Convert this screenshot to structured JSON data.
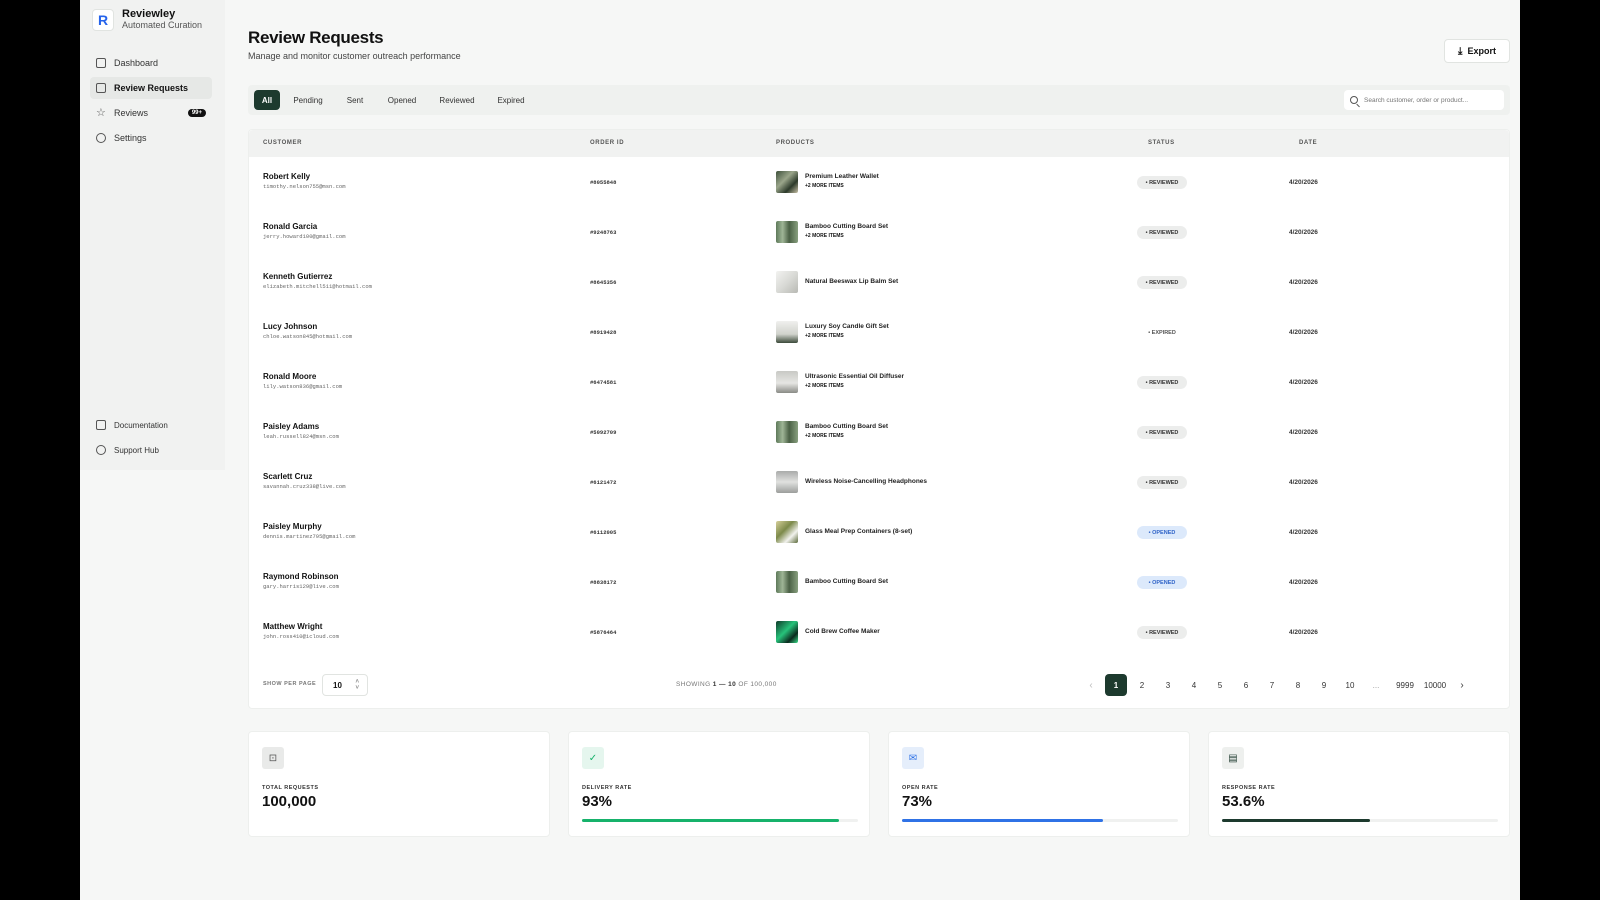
{
  "brand": {
    "name": "Reviewley",
    "tagline": "Automated Curation",
    "logo_letter": "R"
  },
  "sidebar": {
    "items": [
      {
        "label": "Dashboard",
        "icon": "grid-icon"
      },
      {
        "label": "Review Requests",
        "icon": "mail-icon",
        "active": true
      },
      {
        "label": "Reviews",
        "icon": "star-icon",
        "badge": "99+"
      },
      {
        "label": "Settings",
        "icon": "gear-icon"
      }
    ],
    "bottom": [
      {
        "label": "Documentation",
        "icon": "book-icon"
      },
      {
        "label": "Support Hub",
        "icon": "headset-icon"
      }
    ]
  },
  "header": {
    "title": "Review Requests",
    "subtitle": "Manage and monitor customer outreach performance",
    "export_label": "Export"
  },
  "filters": {
    "tabs": [
      "All",
      "Pending",
      "Sent",
      "Opened",
      "Reviewed",
      "Expired"
    ],
    "active": "All",
    "search_placeholder": "Search customer, order or product..."
  },
  "table": {
    "columns": [
      "CUSTOMER",
      "ORDER ID",
      "PRODUCTS",
      "STATUS",
      "DATE"
    ],
    "rows": [
      {
        "name": "Robert Kelly",
        "email": "timothy.nelson755@msn.com",
        "order": "#8055848",
        "product": "Premium Leather Wallet",
        "more": "+2 MORE ITEMS",
        "status": "REVIEWED",
        "date": "4/20/2026"
      },
      {
        "name": "Ronald Garcia",
        "email": "jerry.howard100@gmail.com",
        "order": "#9248763",
        "product": "Bamboo Cutting Board Set",
        "more": "+2 MORE ITEMS",
        "status": "REVIEWED",
        "date": "4/20/2026"
      },
      {
        "name": "Kenneth Gutierrez",
        "email": "elizabeth.mitchell511@hotmail.com",
        "order": "#8645356",
        "product": "Natural Beeswax Lip Balm Set",
        "more": "",
        "status": "REVIEWED",
        "date": "4/20/2026"
      },
      {
        "name": "Lucy Johnson",
        "email": "chloe.watson845@hotmail.com",
        "order": "#8919428",
        "product": "Luxury Soy Candle Gift Set",
        "more": "+2 MORE ITEMS",
        "status": "EXPIRED",
        "date": "4/20/2026"
      },
      {
        "name": "Ronald Moore",
        "email": "lily.watson836@gmail.com",
        "order": "#6474581",
        "product": "Ultrasonic Essential Oil Diffuser",
        "more": "+2 MORE ITEMS",
        "status": "REVIEWED",
        "date": "4/20/2026"
      },
      {
        "name": "Paisley Adams",
        "email": "leah.russell824@msn.com",
        "order": "#5092709",
        "product": "Bamboo Cutting Board Set",
        "more": "+2 MORE ITEMS",
        "status": "REVIEWED",
        "date": "4/20/2026"
      },
      {
        "name": "Scarlett Cruz",
        "email": "savannah.cruz338@live.com",
        "order": "#6121472",
        "product": "Wireless Noise-Cancelling Headphones",
        "more": "",
        "status": "REVIEWED",
        "date": "4/20/2026"
      },
      {
        "name": "Paisley Murphy",
        "email": "dennis.martinez795@gmail.com",
        "order": "#6112005",
        "product": "Glass Meal Prep Containers (8-set)",
        "more": "",
        "status": "OPENED",
        "date": "4/20/2026"
      },
      {
        "name": "Raymond Robinson",
        "email": "gary.harris129@live.com",
        "order": "#8838172",
        "product": "Bamboo Cutting Board Set",
        "more": "",
        "status": "OPENED",
        "date": "4/20/2026"
      },
      {
        "name": "Matthew Wright",
        "email": "john.ross410@icloud.com",
        "order": "#5876464",
        "product": "Cold Brew Coffee Maker",
        "more": "",
        "status": "REVIEWED",
        "date": "4/20/2026"
      }
    ]
  },
  "footer": {
    "per_page_label": "SHOW PER PAGE",
    "per_page_value": "10",
    "showing_prefix": "SHOWING",
    "showing_range": "1 — 10",
    "showing_of": "OF 100,000",
    "pages": [
      "1",
      "2",
      "3",
      "4",
      "5",
      "6",
      "7",
      "8",
      "9",
      "10",
      "...",
      "9999",
      "10000"
    ],
    "current_page": "1",
    "prev_icon": "chevron-left-icon",
    "next_icon": "chevron-right-icon"
  },
  "stats": [
    {
      "label": "TOTAL REQUESTS",
      "value": "100,000",
      "icon": "inbox-icon",
      "color": "#555555",
      "progress": null
    },
    {
      "label": "DELIVERY RATE",
      "value": "93%",
      "icon": "check-circle-icon",
      "color": "#16b26b",
      "progress": 0.93
    },
    {
      "label": "OPEN RATE",
      "value": "73%",
      "icon": "mail-open-icon",
      "color": "#2f72e6",
      "progress": 0.73
    },
    {
      "label": "RESPONSE RATE",
      "value": "53.6%",
      "icon": "chat-icon",
      "color": "#1d3a2e",
      "progress": 0.536
    }
  ],
  "colors": {
    "accent": "#1d3a2e",
    "status_reviewed_bg": "#ecedec",
    "status_expired_bg": "#ffffff",
    "status_opened_bg": "#dce9fb",
    "status_opened_text": "#2f63c8"
  }
}
